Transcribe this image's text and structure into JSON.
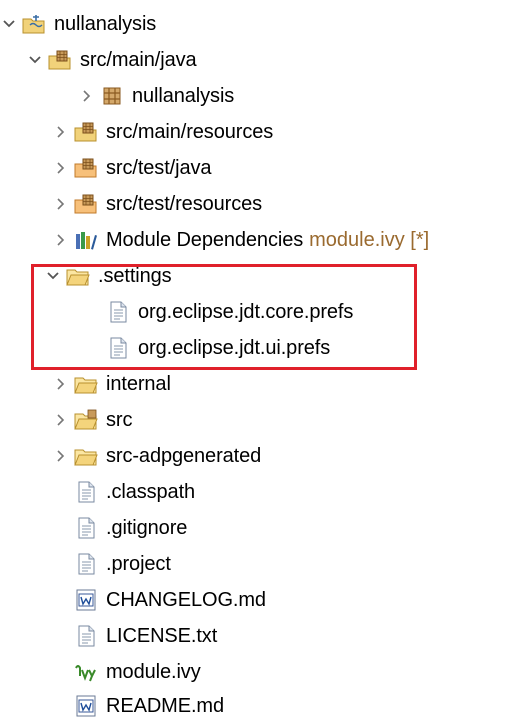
{
  "tree": {
    "items": [
      {
        "label": "nullanalysis",
        "icon": "java-project-icon",
        "expander": "expanded"
      },
      {
        "label": "src/main/java",
        "icon": "source-folder-icon",
        "expander": "expanded"
      },
      {
        "label": "nullanalysis",
        "icon": "package-icon",
        "expander": "collapsed"
      },
      {
        "label": "src/main/resources",
        "icon": "source-folder-icon",
        "expander": "collapsed"
      },
      {
        "label": "src/test/java",
        "icon": "test-source-folder-icon",
        "expander": "collapsed"
      },
      {
        "label": "src/test/resources",
        "icon": "test-source-folder-icon",
        "expander": "collapsed"
      },
      {
        "label": "Module Dependencies",
        "suffix": "module.ivy [*]",
        "icon": "library-icon",
        "expander": "collapsed"
      },
      {
        "label": ".settings",
        "icon": "folder-icon",
        "expander": "expanded"
      },
      {
        "label": "org.eclipse.jdt.core.prefs",
        "icon": "text-file-icon",
        "expander": "none"
      },
      {
        "label": "org.eclipse.jdt.ui.prefs",
        "icon": "text-file-icon",
        "expander": "none"
      },
      {
        "label": "internal",
        "icon": "folder-icon",
        "expander": "collapsed"
      },
      {
        "label": "src",
        "icon": "source-folder-icon",
        "expander": "collapsed"
      },
      {
        "label": "src-adpgenerated",
        "icon": "folder-icon",
        "expander": "collapsed"
      },
      {
        "label": ".classpath",
        "icon": "text-file-icon",
        "expander": "none"
      },
      {
        "label": ".gitignore",
        "icon": "text-file-icon",
        "expander": "none"
      },
      {
        "label": ".project",
        "icon": "text-file-icon",
        "expander": "none"
      },
      {
        "label": "CHANGELOG.md",
        "icon": "word-document-icon",
        "expander": "none"
      },
      {
        "label": "LICENSE.txt",
        "icon": "text-file-icon",
        "expander": "none"
      },
      {
        "label": "module.ivy",
        "icon": "ivy-file-icon",
        "expander": "none"
      },
      {
        "label": "README.md",
        "icon": "word-document-icon",
        "expander": "none"
      }
    ]
  },
  "colors": {
    "highlight": "#e0202a",
    "decoration": "#9a6a2f",
    "folder": "#e8c65a",
    "chevron": "#555555"
  }
}
